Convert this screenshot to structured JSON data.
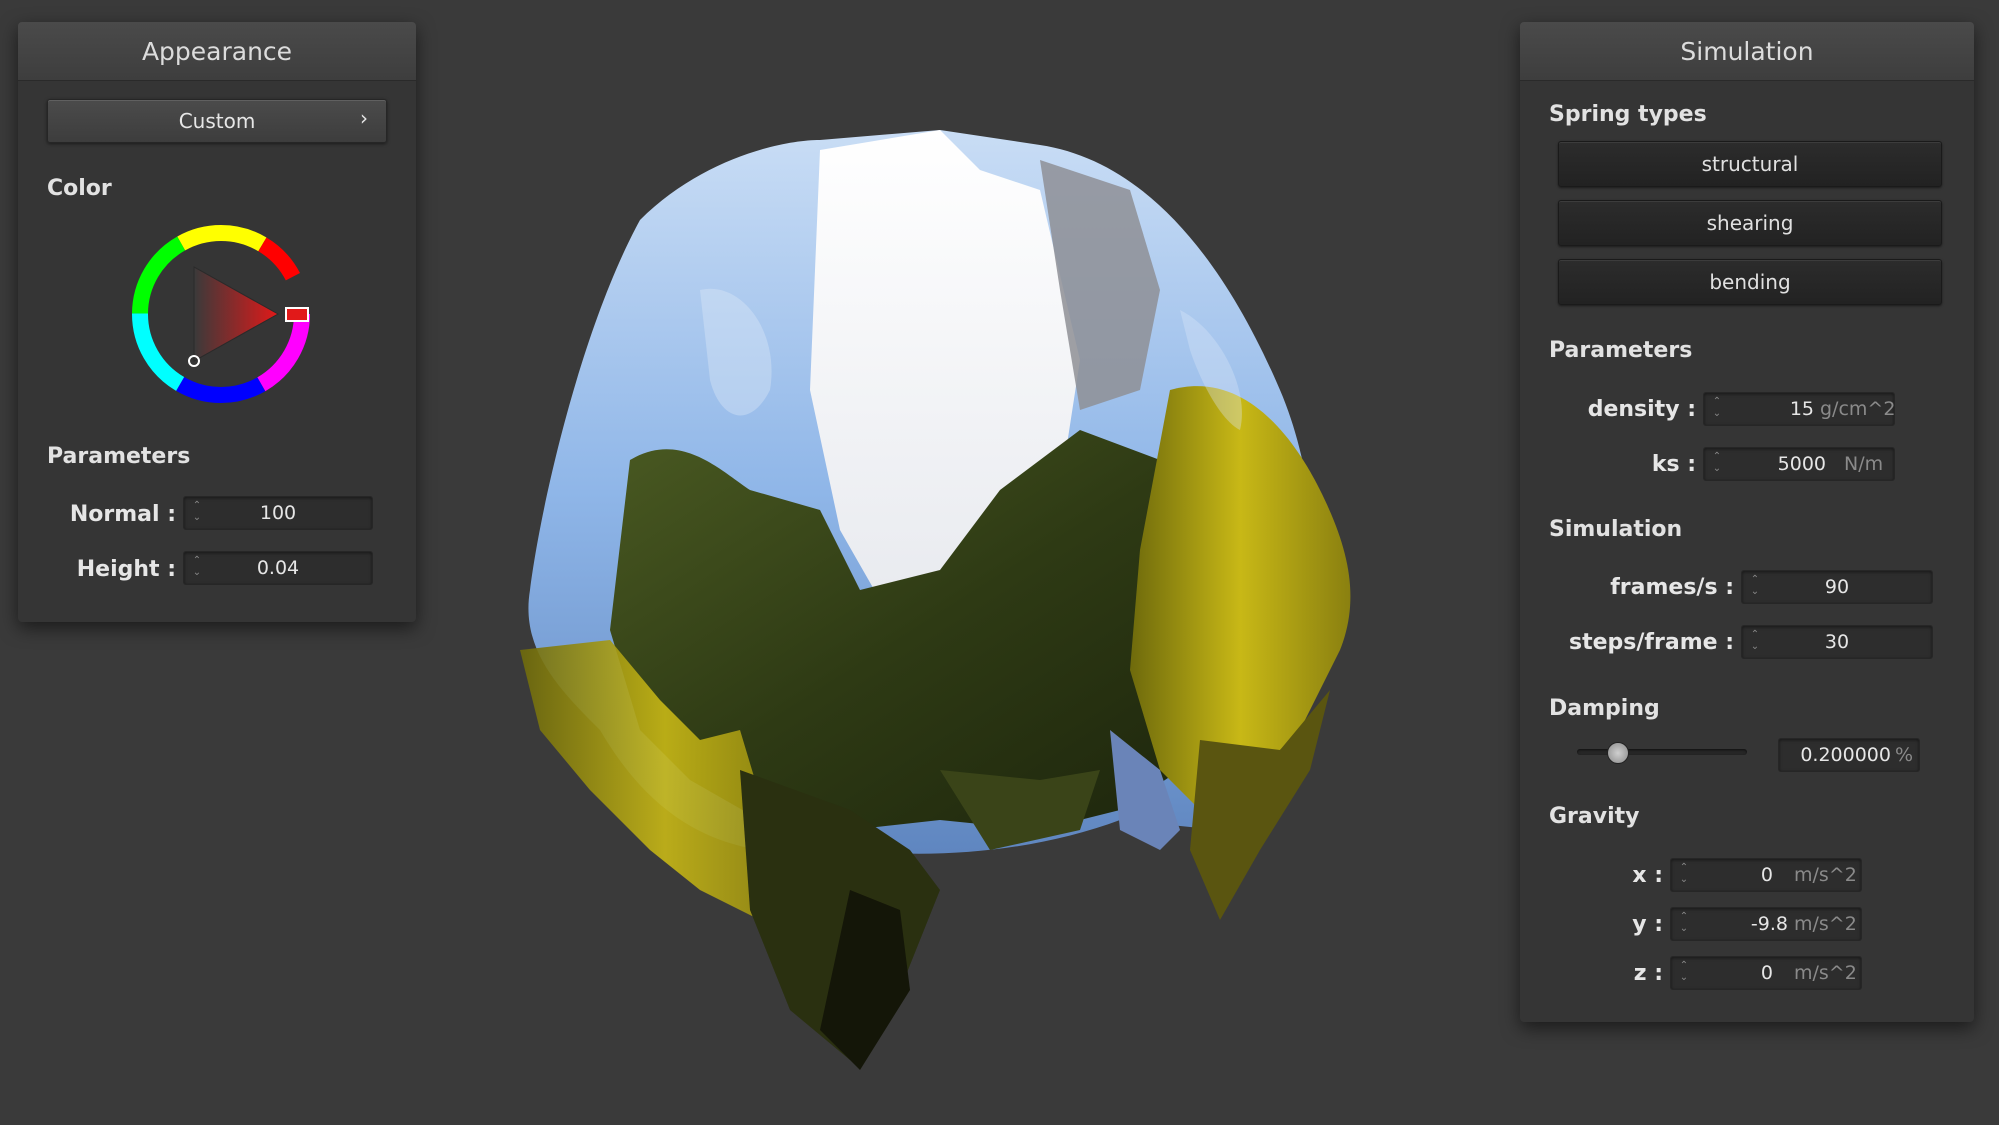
{
  "appearance": {
    "title": "Appearance",
    "preset_button": "Custom",
    "preset_chevron": "›",
    "color_label": "Color",
    "color_picker_hue": "#e11919",
    "parameters_label": "Parameters",
    "normal_label": "Normal :",
    "normal_value": "100",
    "height_label": "Height :",
    "height_value": "0.04"
  },
  "simulation": {
    "title": "Simulation",
    "spring_types_label": "Spring types",
    "spring_buttons": [
      "structural",
      "shearing",
      "bending"
    ],
    "parameters_label": "Parameters",
    "density_label": "density :",
    "density_value": "15",
    "density_unit": "g/cm^2",
    "ks_label": "ks :",
    "ks_value": "5000",
    "ks_unit": "N/m",
    "simulation_label": "Simulation",
    "fps_label": "frames/s :",
    "fps_value": "90",
    "steps_label": "steps/frame :",
    "steps_value": "30",
    "damping_label": "Damping",
    "damping_value": "0.200000",
    "damping_unit": "%",
    "damping_slider_fraction": 0.2,
    "gravity_label": "Gravity",
    "gx_label": "x :",
    "gx_value": "0",
    "gy_label": "y :",
    "gy_value": "-9.8",
    "gz_label": "z :",
    "gz_value": "0",
    "gravity_unit": "m/s^2"
  },
  "viewport": {
    "background": "#3a3a3a"
  }
}
